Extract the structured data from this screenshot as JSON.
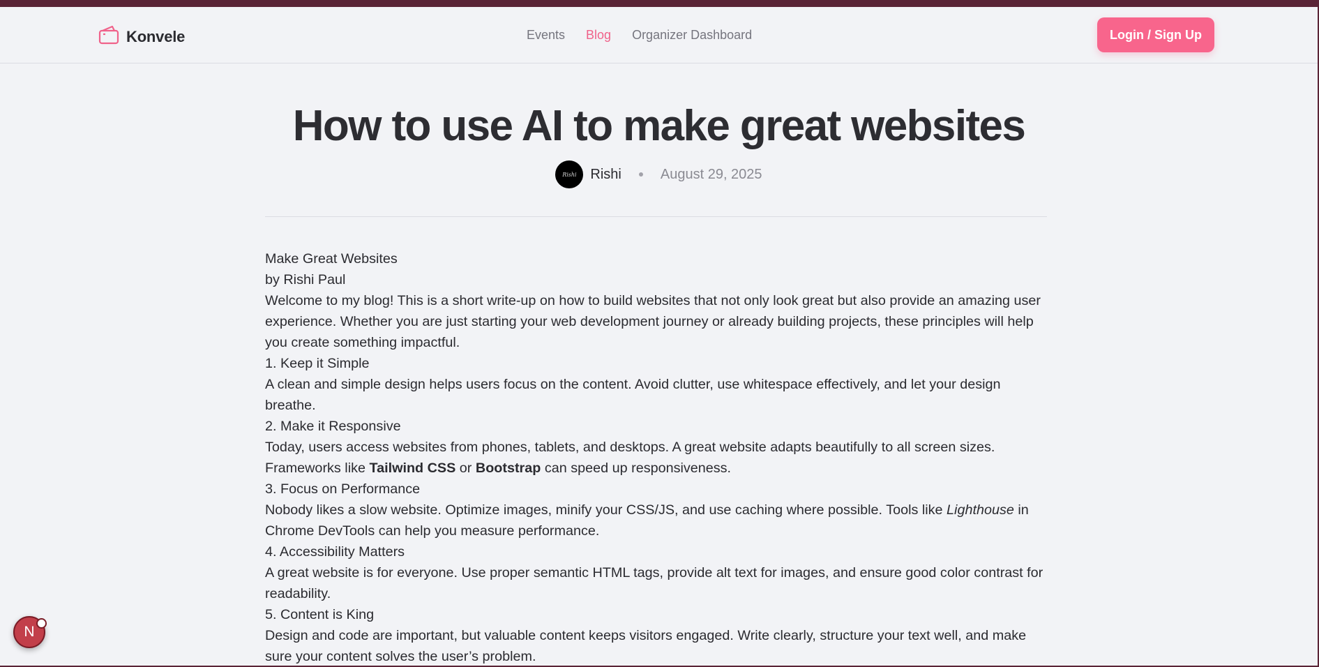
{
  "nav": {
    "brand": "Konvele",
    "links": [
      "Events",
      "Blog",
      "Organizer Dashboard"
    ],
    "active_link": "Blog",
    "login_label": "Login / Sign Up"
  },
  "post": {
    "title": "How to use AI to make great websites",
    "author": "Rishi",
    "avatar_text": "Rishi",
    "date": "August 29, 2025",
    "heading": "Make Great Websites",
    "byline": "by Rishi Paul",
    "intro": "Welcome to my blog! This is a short write-up on how to build websites that not only look great but also provide an amazing user experience. Whether you are just starting your web development journey or already building projects, these principles will help you create something impactful.",
    "s1_title": "1. Keep it Simple",
    "s1_body": "A clean and simple design helps users focus on the content. Avoid clutter, use whitespace effectively, and let your design breathe.",
    "s2_title": "2. Make it Responsive",
    "s2_body_a": "Today, users access websites from phones, tablets, and desktops. A great website adapts beautifully to all screen sizes. Frameworks like ",
    "s2_bold_1": "Tailwind CSS",
    "s2_body_b": " or ",
    "s2_bold_2": "Bootstrap",
    "s2_body_c": " can speed up responsiveness.",
    "s3_title": "3. Focus on Performance",
    "s3_body_a": "Nobody likes a slow website. Optimize images, minify your CSS/JS, and use caching where possible. Tools like ",
    "s3_italic": "Lighthouse",
    "s3_body_b": " in Chrome DevTools can help you measure performance.",
    "s4_title": "4. Accessibility Matters",
    "s4_body": "A great website is for everyone. Use proper semantic HTML tags, provide alt text for images, and ensure good color contrast for readability.",
    "s5_title": "5. Content is King",
    "s5_body": "Design and code are important, but valuable content keeps visitors engaged. Write clearly, structure your text well, and make sure your content solves the user’s problem."
  },
  "badge": {
    "letter": "N"
  },
  "colors": {
    "accent": "#f8658c",
    "frame": "#5a2436",
    "page_bg": "#f2f3f6"
  },
  "icons": {
    "brand": "ticket-icon"
  }
}
